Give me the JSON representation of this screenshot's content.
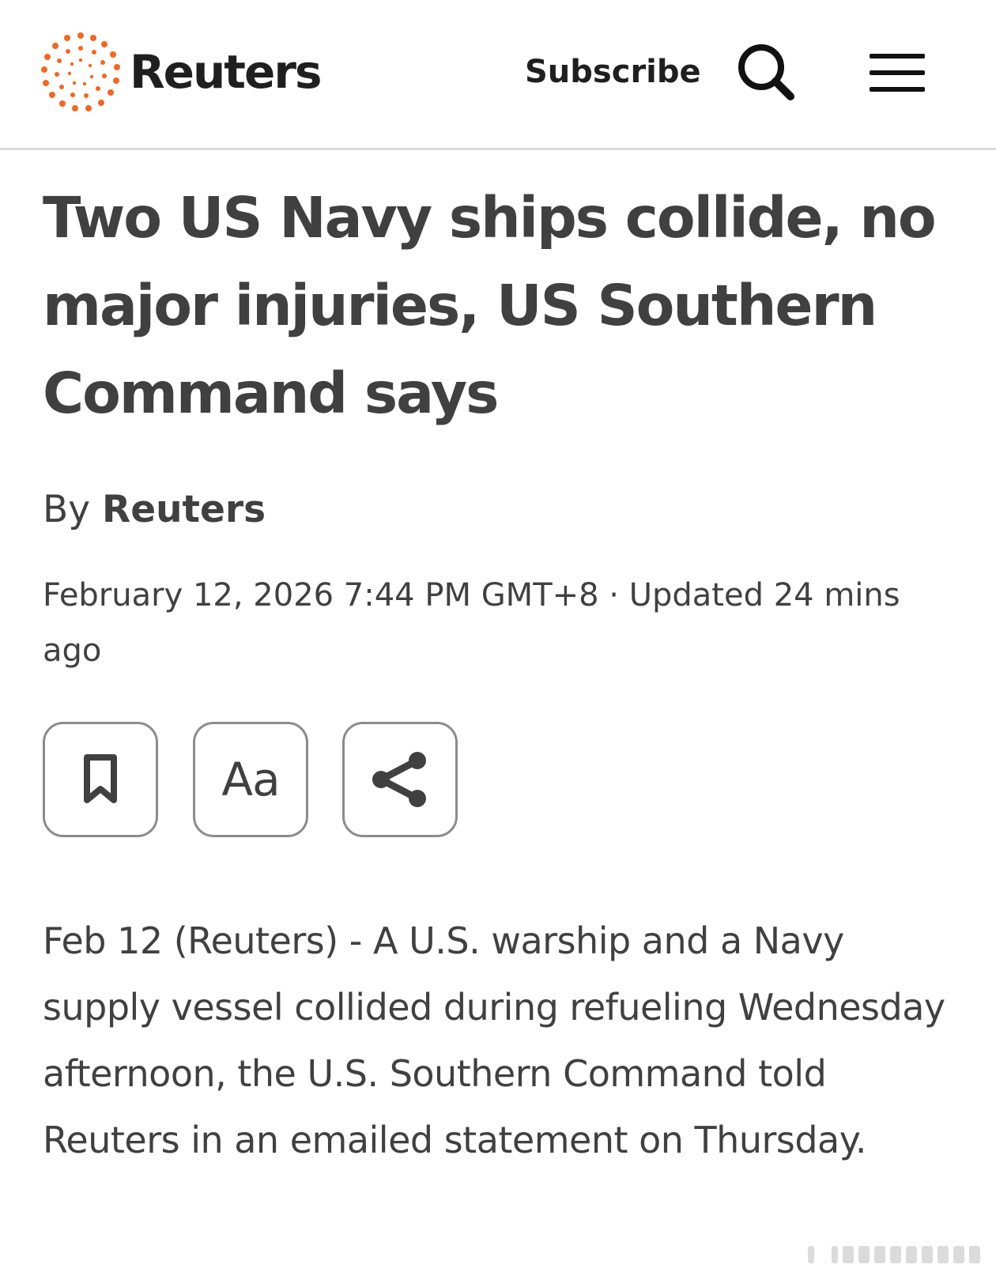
{
  "header": {
    "brand": "Reuters",
    "subscribe_label": "Subscribe",
    "search_icon": "search-icon",
    "menu_icon": "hamburger-menu-icon",
    "brand_color": "#f26722"
  },
  "article": {
    "headline": "Two US Navy ships collide, no major injuries, US Southern Command says",
    "byline_prefix": "By",
    "byline_author": "Reuters",
    "dateline": "February 12, 2026 7:44 PM GMT+8 · Updated 24 mins ago",
    "body": "Feb 12 (Reuters) - A U.S. warship and a Navy supply vessel collided during refueling Wednesday afternoon, the U.S. Southern Command told Reuters in an emailed statement on Thursday."
  },
  "toolbar": {
    "bookmark_icon": "bookmark-icon",
    "font_size_label": "Aa",
    "share_icon": "share-icon"
  }
}
